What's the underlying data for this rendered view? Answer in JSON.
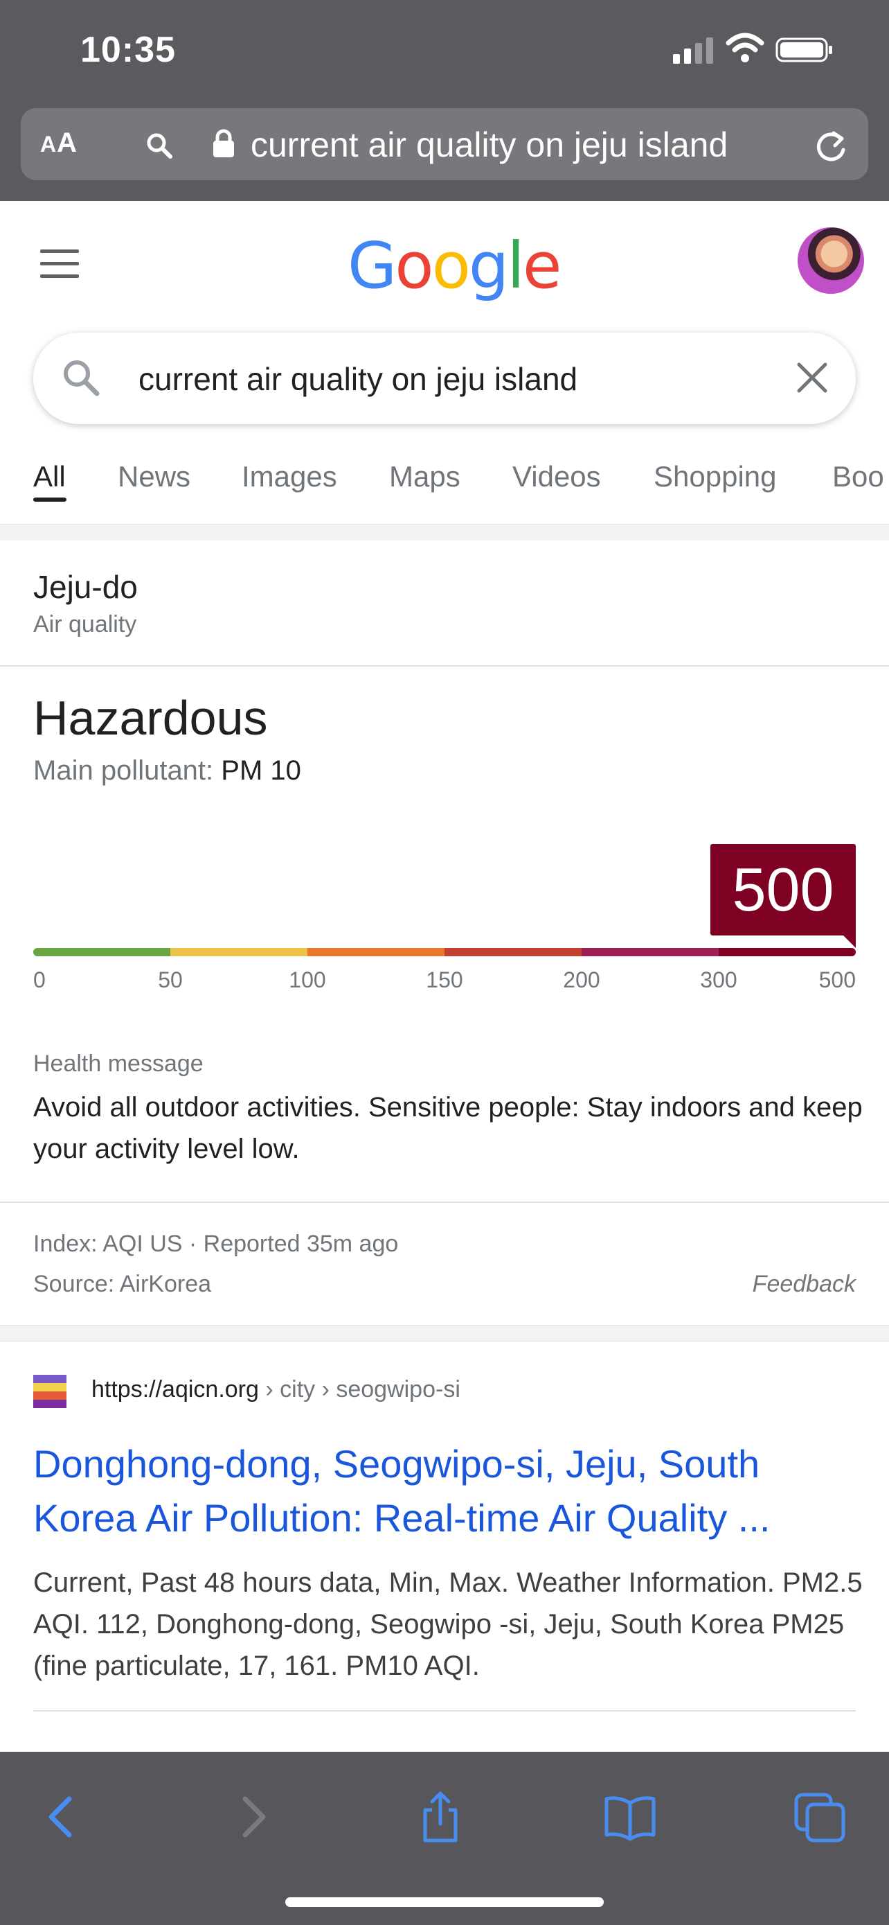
{
  "status_bar": {
    "time": "10:35"
  },
  "address_bar": {
    "aa_label_big": "A",
    "aa_label_small": "A",
    "url_text": "current air quality on jeju island"
  },
  "header": {
    "logo_letters": [
      {
        "ch": "G",
        "color": "#4285F4"
      },
      {
        "ch": "o",
        "color": "#EA4335"
      },
      {
        "ch": "o",
        "color": "#FBBC05"
      },
      {
        "ch": "g",
        "color": "#4285F4"
      },
      {
        "ch": "l",
        "color": "#34A853"
      },
      {
        "ch": "e",
        "color": "#EA4335"
      }
    ]
  },
  "search": {
    "query": "current air quality on jeju island"
  },
  "tabs": [
    "All",
    "News",
    "Images",
    "Maps",
    "Videos",
    "Shopping",
    "Boo"
  ],
  "aq_card": {
    "location": "Jeju-do",
    "subtitle": "Air quality",
    "status": "Hazardous",
    "pollutant_label": "Main pollutant:",
    "pollutant_value": "PM 10",
    "aqi_value": "500",
    "aqi_fraction_of_scale": 1.0,
    "scale_colors": [
      "#6aa543",
      "#eec34a",
      "#e8782e",
      "#c2402f",
      "#9d1f55",
      "#7e0023"
    ],
    "scale_ticks": [
      "0",
      "50",
      "100",
      "150",
      "200",
      "300",
      "500"
    ],
    "health_label": "Health message",
    "health_text": "Avoid all outdoor activities. Sensitive people: Stay indoors and keep your activity level low.",
    "index_line": "Index: AQI US · Reported 35m ago",
    "source_line": "Source: AirKorea",
    "feedback": "Feedback"
  },
  "result": {
    "site": "https://aqicn.org",
    "crumbs": " › city › seogwipo-si",
    "title": "Donghong-dong, Seogwipo-si, Jeju, South Korea Air Pollution: Real-time Air Quality ...",
    "snippet": "Current, Past 48 hours data, Min, Max. Weather Information. PM2.5 AQI. 112, Donghong-dong, Seogwipo -si, Jeju, South Korea PM25 (fine particulate, 17, 161. PM10 AQI.",
    "favicon_colors": [
      "#7a5ac8",
      "#f2d24a",
      "#e65a3c",
      "#7a2ca0"
    ]
  },
  "colors": {
    "accent_blue": "#4a8df0",
    "link_blue": "#1a56db",
    "hazardous": "#7e0023"
  }
}
